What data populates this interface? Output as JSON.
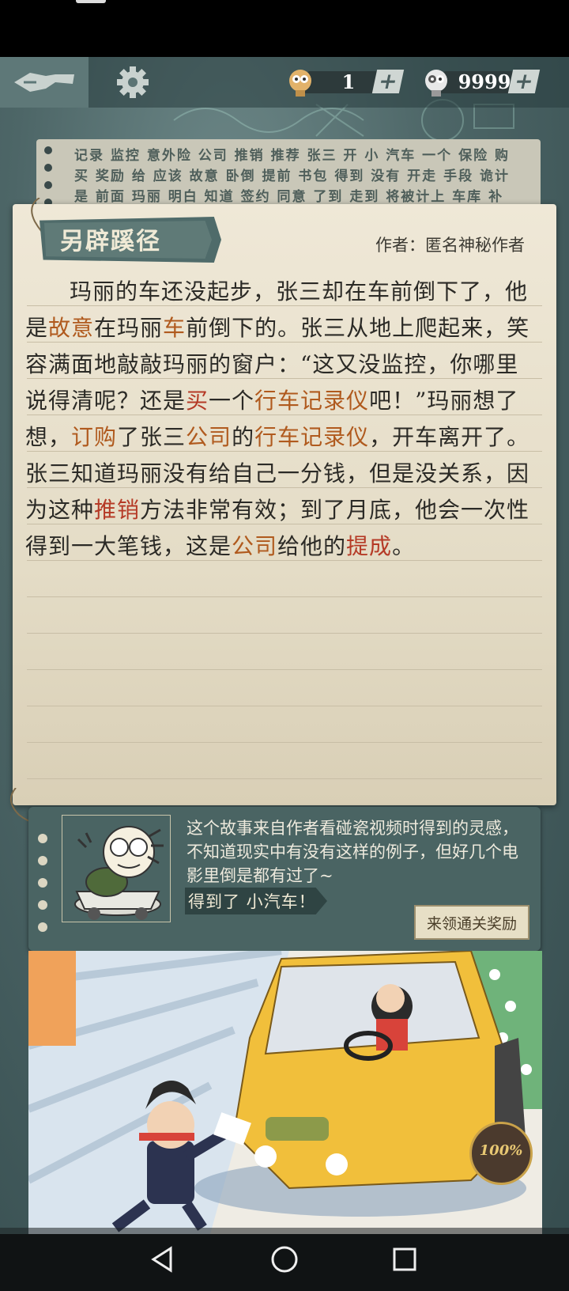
{
  "topbar": {
    "currency_a": {
      "value": "1",
      "plus": "+",
      "icon": "mascot-head-icon"
    },
    "currency_b": {
      "value": "9999",
      "plus": "+",
      "icon": "mascot-head-dark-icon"
    }
  },
  "background_strip": {
    "line1": "记录 监控 意外险 公司 推销 推荐 张三 开 小 汽车 一个 保险 购",
    "line2": "买 奖励 给 应该 故意 卧倒 提前 书包 得到 没有 开走 手段 诡计",
    "line3": "是 前面 玛丽 明白 知道 签约 同意 了到 走到 将被计上 车库 补"
  },
  "story": {
    "title": "另辟蹊径",
    "author": "作者：匿名神秘作者",
    "segments": [
      {
        "t": "玛丽的车还没起步，张三却在车前倒下了，他是",
        "c": ""
      },
      {
        "t": "故意",
        "c": "hl"
      },
      {
        "t": "在玛丽",
        "c": ""
      },
      {
        "t": "车",
        "c": "hl"
      },
      {
        "t": "前倒下的。张三从地上爬起来，笑容满面地敲敲玛丽的窗户：“这又没监控，你哪里说得清呢？还是",
        "c": ""
      },
      {
        "t": "买",
        "c": "hl-r"
      },
      {
        "t": "一个",
        "c": ""
      },
      {
        "t": "行车记录仪",
        "c": "hl"
      },
      {
        "t": "吧！”玛丽想了想，",
        "c": ""
      },
      {
        "t": "订购",
        "c": "hl"
      },
      {
        "t": "了张三",
        "c": ""
      },
      {
        "t": "公司",
        "c": "hl"
      },
      {
        "t": "的",
        "c": ""
      },
      {
        "t": "行车记录仪",
        "c": "hl"
      },
      {
        "t": "，开车离开了。张三知道玛丽没有给自己一分钱，但是没关系，因为这种",
        "c": ""
      },
      {
        "t": "推销",
        "c": "hl-r"
      },
      {
        "t": "方法非常有效；到了月底，他会一次性得到一大笔钱，这是",
        "c": ""
      },
      {
        "t": "公司",
        "c": "hl"
      },
      {
        "t": "给他的",
        "c": ""
      },
      {
        "t": "提成",
        "c": "hl-r"
      },
      {
        "t": "。",
        "c": ""
      }
    ]
  },
  "card": {
    "description": "这个故事来自作者看碰瓷视频时得到的灵感，不知道现实中有没有这样的例子，但好几个电影里倒是都有过了~",
    "reward": "得到了 小汽车！",
    "claim_button": "来领通关奖励"
  },
  "illustration": {
    "progress_label": "100%",
    "progress": 1.0
  },
  "colors": {
    "highlight_orange": "#b05a1e",
    "highlight_red": "#b53a26",
    "panel_teal": "#4a6463"
  }
}
